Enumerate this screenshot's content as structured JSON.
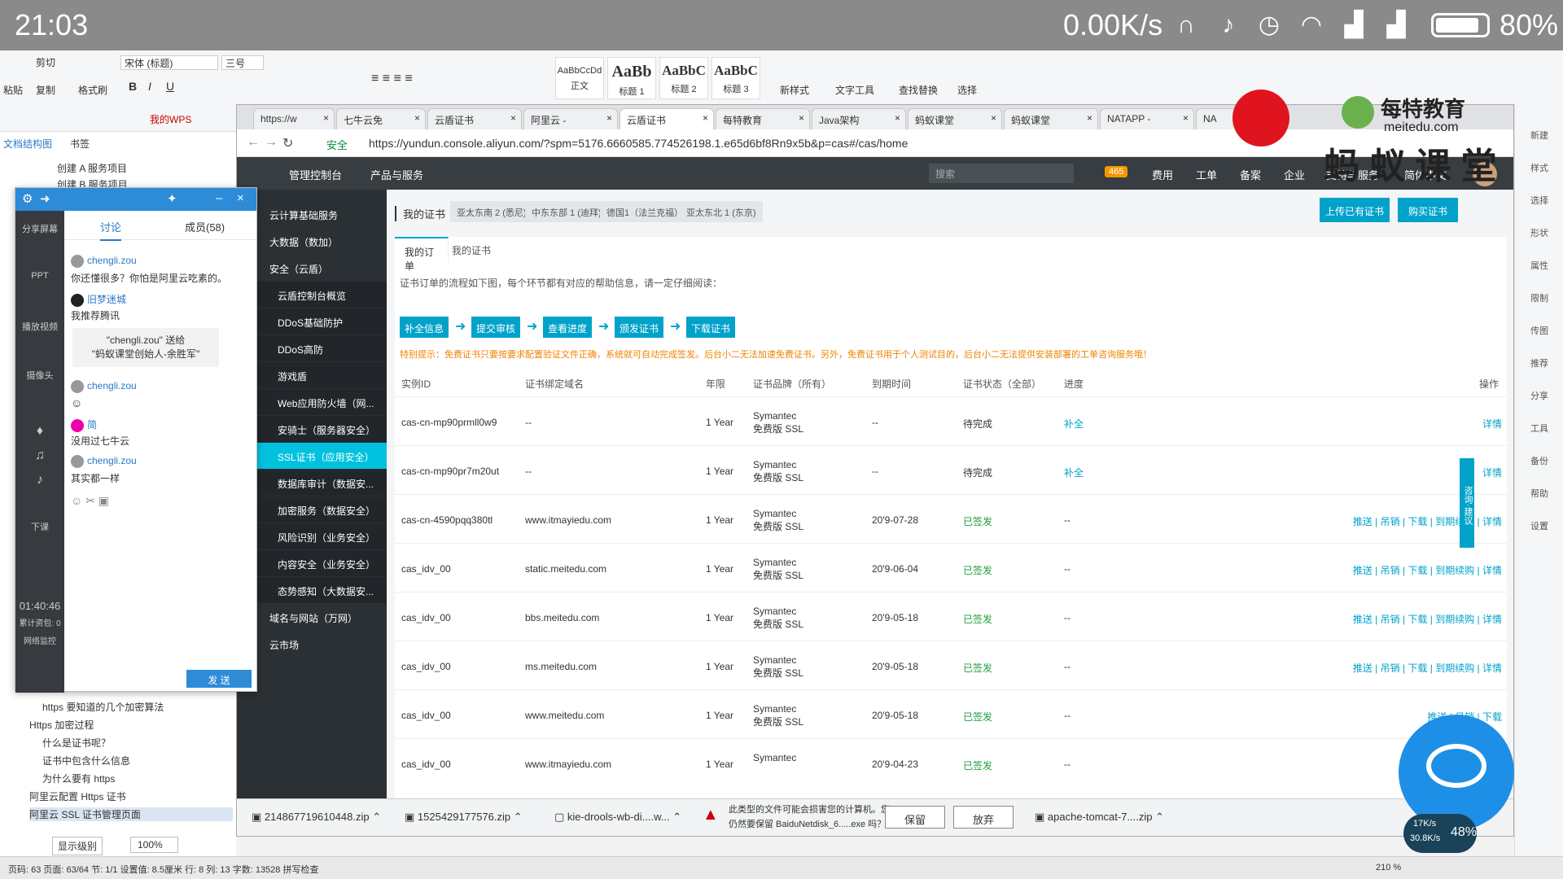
{
  "status_bar": {
    "time": "21:03",
    "net_speed": "0.00K/s",
    "battery": "80%"
  },
  "wps": {
    "font_name": "宋体 (标题)",
    "font_size": "三号",
    "paste": "粘贴",
    "cut": "剪切",
    "copy": "复制",
    "format_painter": "格式刷",
    "styles": [
      {
        "sample": "AaBbCcDd",
        "label": "正文"
      },
      {
        "sample": "AaBb",
        "label": "标题 1"
      },
      {
        "sample": "AaBbC",
        "label": "标题 2"
      },
      {
        "sample": "AaBbC",
        "label": "标题 3"
      }
    ],
    "new_style": "新样式",
    "text_tool": "文字工具",
    "find_replace": "查找替换",
    "select": "选择",
    "my_wps": "我的WPS",
    "search": "搜索",
    "doc_nav_tabs": [
      "文档结构图",
      "书签"
    ],
    "outline_top": [
      "创建 A 服务项目",
      "创建 B 服务项目"
    ],
    "outline_bottom": [
      "https 要知道的几个加密算法",
      "Https 加密过程",
      "什么是证书呢？",
      "证书中包含什么信息",
      "为什么要有 https",
      "阿里云配置 Https 证书",
      "阿里云 SSL 证书管理页面"
    ],
    "display_level": "显示级别",
    "zoom": "100%",
    "statusbar": "页码: 63  页面: 63/64  节: 1/1  设置值: 8.5厘米  行: 8  列: 13  字数: 13528  拼写检查",
    "zoom_right": "210 %"
  },
  "right_sidebar": [
    "新建",
    "样式",
    "选择",
    "形状",
    "属性",
    "限制",
    "传图",
    "推荐",
    "分享",
    "工具",
    "备份",
    "帮助",
    "设置"
  ],
  "chat": {
    "tabs": [
      "讨论",
      "成员(58)"
    ],
    "sidebar": [
      "分享屏幕",
      "PPT",
      "播放视频",
      "摄像头",
      "下课"
    ],
    "timer": "01:40:46",
    "cumulative": "累计资包: 0",
    "net_monitor": "网络监控",
    "messages": [
      {
        "user": "chengli.zou",
        "text": "你还懂很多？你怕是阿里云吃素的。"
      },
      {
        "user": "旧梦迷城",
        "text": "我推荐腾讯"
      },
      {
        "user": "chengli.zou",
        "text": ""
      },
      {
        "user": "简",
        "text": "没用过七牛云"
      },
      {
        "user": "chengli.zou",
        "text": "其实都一样"
      }
    ],
    "gift_line1": "\"chengli.zou\" 送给",
    "gift_line2": "\"蚂蚁课堂创始人-余胜军\"",
    "send": "发 送"
  },
  "browser": {
    "tabs": [
      "https://w",
      "七牛云免",
      "云盾证书",
      "阿里云 -",
      "云盾证书",
      "每特教育",
      "Java架构",
      "蚂蚁课堂",
      "蚂蚁课堂",
      "NATAPP -",
      "NA"
    ],
    "secure": "安全",
    "url": "https://yundun.console.aliyun.com/?spm=5176.6660585.774526198.1.e65d6bf8Rn9x5b&p=cas#/cas/home"
  },
  "console": {
    "topnav": [
      "管理控制台",
      "产品与服务",
      "搜索",
      "465",
      "费用",
      "工单",
      "备案",
      "企业",
      "支持与服务",
      "简体中文"
    ],
    "sidenav": [
      {
        "label": "云计算基础服务",
        "type": "group"
      },
      {
        "label": "大数据（数加）",
        "type": "group"
      },
      {
        "label": "安全（云盾）",
        "type": "group"
      },
      {
        "label": "云盾控制台概览",
        "type": "sub"
      },
      {
        "label": "DDoS基础防护",
        "type": "sub"
      },
      {
        "label": "DDoS高防",
        "type": "sub"
      },
      {
        "label": "游戏盾",
        "type": "sub"
      },
      {
        "label": "Web应用防火墙（网...",
        "type": "sub"
      },
      {
        "label": "安骑士（服务器安全）",
        "type": "sub"
      },
      {
        "label": "SSL证书（应用安全）",
        "type": "active"
      },
      {
        "label": "数据库审计（数据安...",
        "type": "sub"
      },
      {
        "label": "加密服务（数据安全）",
        "type": "sub"
      },
      {
        "label": "风险识别（业务安全）",
        "type": "sub"
      },
      {
        "label": "内容安全（业务安全）",
        "type": "sub"
      },
      {
        "label": "态势感知（大数据安...",
        "type": "sub"
      },
      {
        "label": "域名与网站（万网）",
        "type": "group"
      },
      {
        "label": "云市场",
        "type": "group"
      }
    ],
    "region_label": "我的证书",
    "regions": [
      "亚太东南 2 (悉尼)",
      "中东东部 1 (迪拜)",
      "德国1（法兰克福）",
      "亚太东北 1 (东京)"
    ],
    "upload_btn": "上传已有证书",
    "buy_btn": "购买证书",
    "subtabs": [
      "我的订单",
      "我的证书"
    ],
    "flow_hint": "证书订单的流程如下图，每个环节都有对应的帮助信息，请一定仔细阅读：",
    "steps": [
      "补全信息",
      "提交审核",
      "查看进度",
      "颁发证书",
      "下载证书"
    ],
    "special_tip": "特别提示：免费证书只要按要求配置验证文件正确，系统就可自动完成签发。后台小二无法加速免费证书。另外，免费证书用于个人测试目的，后台小二无法提供安装部署的工单咨询服务哦！",
    "columns": [
      "实例ID",
      "证书绑定域名",
      "年限",
      "证书品牌（所有）",
      "到期时间",
      "证书状态（全部）",
      "进度",
      "操作"
    ],
    "rows": [
      {
        "id": "cas-cn-mp90prmll0w9",
        "domain": "--",
        "years": "1 Year",
        "brand": "Symantec",
        "brand2": "免费版 SSL",
        "expire": "--",
        "status": "待完成",
        "progress": "补全",
        "ops": "详情"
      },
      {
        "id": "cas-cn-mp90pr7m20ut",
        "domain": "--",
        "years": "1 Year",
        "brand": "Symantec",
        "brand2": "免费版 SSL",
        "expire": "--",
        "status": "待完成",
        "progress": "补全",
        "ops": "详情"
      },
      {
        "id": "cas-cn-4590pqq380tl",
        "domain": "www.itmayiedu.com",
        "years": "1 Year",
        "brand": "Symantec",
        "brand2": "免费版 SSL",
        "expire": "20'9-07-28",
        "status": "已签发",
        "progress": "--",
        "ops": "推送 | 吊销 | 下载 | 到期续购 | 详情"
      },
      {
        "id": "cas_idv_00",
        "domain": "static.meitedu.com",
        "years": "1 Year",
        "brand": "Symantec",
        "brand2": "免费版 SSL",
        "expire": "20'9-06-04",
        "status": "已签发",
        "progress": "--",
        "ops": "推送 | 吊销 | 下载 | 到期续购 | 详情"
      },
      {
        "id": "cas_idv_00",
        "domain": "bbs.meitedu.com",
        "years": "1 Year",
        "brand": "Symantec",
        "brand2": "免费版 SSL",
        "expire": "20'9-05-18",
        "status": "已签发",
        "progress": "--",
        "ops": "推送 | 吊销 | 下载 | 到期续购 | 详情"
      },
      {
        "id": "cas_idv_00",
        "domain": "ms.meitedu.com",
        "years": "1 Year",
        "brand": "Symantec",
        "brand2": "免费版 SSL",
        "expire": "20'9-05-18",
        "status": "已签发",
        "progress": "--",
        "ops": "推送 | 吊销 | 下载 | 到期续购 | 详情"
      },
      {
        "id": "cas_idv_00",
        "domain": "www.meitedu.com",
        "years": "1 Year",
        "brand": "Symantec",
        "brand2": "免费版 SSL",
        "expire": "20'9-05-18",
        "status": "已签发",
        "progress": "--",
        "ops": "推送 | 吊销 | 下载"
      },
      {
        "id": "cas_idv_00",
        "domain": "www.itmayiedu.com",
        "years": "1 Year",
        "brand": "Symantec",
        "brand2": "",
        "expire": "20'9-04-23",
        "status": "已签发",
        "progress": "--",
        "ops": "推送 | 吊销 | 下载"
      }
    ],
    "side_float": "咨询·建议"
  },
  "downloads": {
    "items": [
      "214867719610448.zip",
      "1525429177576.zip",
      "kie-drools-wb-di....w...",
      "apache-tomcat-7....zip"
    ],
    "warning_line1": "此类型的文件可能会损害您的计算机。您",
    "warning_line2": "仍然要保留 BaiduNetdisk_6.....exe 吗？",
    "keep": "保留",
    "discard": "放弃"
  },
  "overlay": {
    "brand_top": "每特教育",
    "brand_url": "meitedu.com",
    "brand_main": "蚂 蚁 课 堂",
    "speed_up": "17K/s",
    "speed_down": "30.8K/s",
    "speed_pct": "48%"
  },
  "colors": {
    "aliyun_blue": "#00a2ca",
    "console_dark": "#373d41",
    "sidenav": "#2b3034",
    "active": "#00c1de",
    "issued": "#1e9e3e",
    "tip": "#f08300"
  }
}
